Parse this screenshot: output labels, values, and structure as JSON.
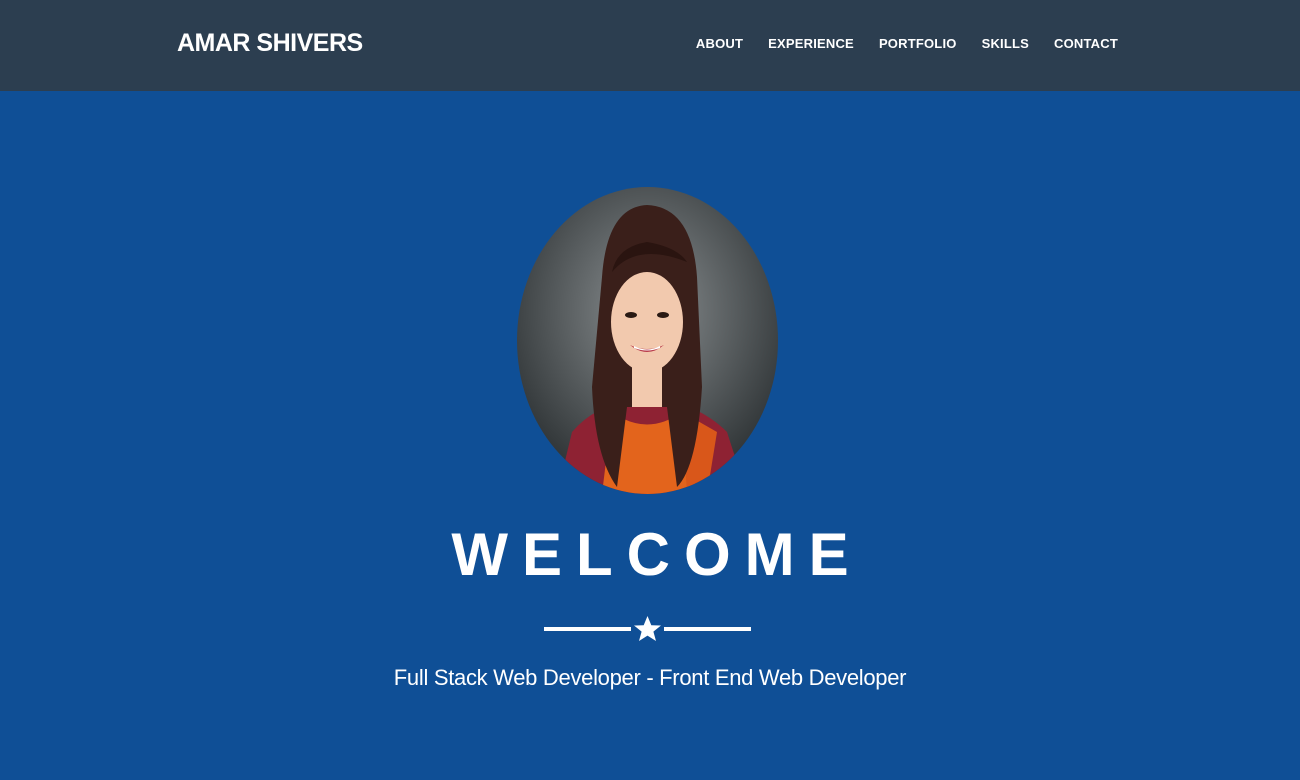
{
  "brand": "AMAR SHIVERS",
  "nav": {
    "items": [
      "ABOUT",
      "EXPERIENCE",
      "PORTFOLIO",
      "SKILLS",
      "CONTACT"
    ]
  },
  "hero": {
    "heading": "WELCOME",
    "subtitle": "Full Stack Web Developer - Front End Web Developer",
    "divider_icon": "star-icon"
  },
  "colors": {
    "navbar_bg": "#2c3e50",
    "hero_bg": "#0f4f96",
    "text": "#ffffff",
    "robe_orange": "#e3641c",
    "robe_red": "#8e2233",
    "hair": "#3a1f1a",
    "skin": "#f2c9ae",
    "photo_bg": "#5d6467"
  }
}
